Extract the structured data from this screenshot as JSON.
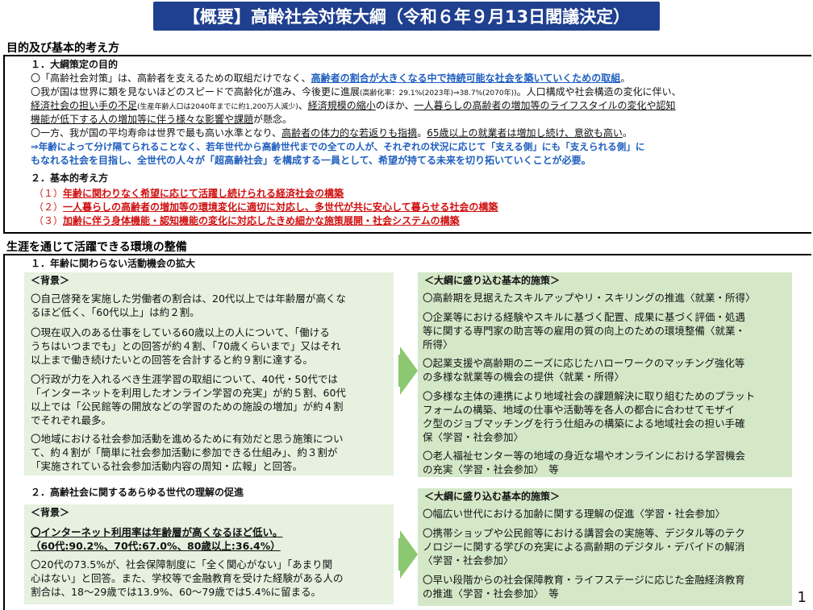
{
  "title": "【概要】高齢社会対策大綱（令和６年９月13日閣議決定）",
  "section1": {
    "heading": "目的及び基本的考え方",
    "sub1": "１．大綱策定の目的",
    "p1a": "〇「高齢社会対策」は、高齢者を支えるための取組だけでなく、",
    "p1b": "高齢者の割合が大きくなる中で持続可能な社会を築いていくための取組",
    "p1c": "。",
    "p2a": "〇我が国は世界に類を見ないほどのスピードで高齢化が進み、今後更に進展",
    "p2b": "(高齢化率：29.1%(2023年)⇒38.7%(2070年))",
    "p2c": "。人口構成や社会構造の変化に伴い、",
    "p3a": "経済社会の担い手の不足",
    "p3b": "(生産年齢人口は2040年までに約1,200万人減少)",
    "p3c": "、",
    "p3d": "経済規模の縮小",
    "p3e": "のほか、",
    "p3f": "一人暮らしの高齢者の増加等のライフスタイルの変化や認知",
    "p4a": "機能が低下する人の増加等に伴う様々な影響や課題",
    "p4b": "が懸念。",
    "p5a": "〇一方、我が国の平均寿命は世界で最も高い水準となり、",
    "p5b": "高齢者の体力的な若返りも指摘",
    "p5c": "。",
    "p5d": "65歳以上の就業者は増加し続け、意欲も高い",
    "p5e": "。",
    "p6": "⇒年齢によって分け隔てられることなく、若年世代から高齢世代までの全ての人が、それぞれの状況に応じて「支える側」にも「支えられる側」に",
    "p7": "もなれる社会を目指し、全世代の人々が「超高齢社会」を構成する一員として、希望が持てる未来を切り拓いていくことが必要。",
    "sub2": "２．基本的考え方",
    "items": [
      {
        "num": "（１）",
        "text": "年齢に関わりなく希望に応じて活躍し続けられる経済社会の構築"
      },
      {
        "num": "（２）",
        "text": "一人暮らしの高齢者の増加等の環境変化に適切に対応し、多世代が共に安心して暮らせる社会の構築"
      },
      {
        "num": "（３）",
        "text": "加齢に伴う身体機能・認知機能の変化に対応したきめ細かな施策展開・社会システムの構築"
      }
    ]
  },
  "section2": {
    "heading": "生涯を通じて活躍できる環境の整備",
    "sub1": "１．年齢に関わらない活動機会の拡大",
    "bg_label": "＜背景＞",
    "left1": [
      "〇自己啓発を実施した労働者の割合は、20代以上では年齢層が高くな",
      "るほど低く、「60代以上」は約２割。",
      "〇現在収入のある仕事をしている60歳以上の人について、「働ける",
      "うちはいつまでも」との回答が約４割、「70歳くらいまで」又はそれ",
      "以上まで働き続けたいとの回答を合計すると約９割に達する。",
      "〇行政が力を入れるべき生涯学習の取組について、40代・50代では",
      "「インターネットを利用したオンライン学習の充実」が約５割、60代",
      "以上では「公民館等の開放などの学習のための施設の増加」が約４割",
      "でそれぞれ最多。",
      "〇地域における社会参加活動を進めるために有効だと思う施策につい",
      "て、約４割が「簡単に社会参加活動に参加できる仕組み」、約３割が",
      "「実施されている社会参加活動内容の周知・広報」と回答。"
    ],
    "right_label": "＜大綱に盛り込む基本的施策＞",
    "right1": [
      "〇高齢期を見据えたスキルアップやリ・スキリングの推進〈就業・所得〉",
      "〇企業等における経験やスキルに基づく配置、成果に基づく評価・処遇",
      "等に関する専門家の助言等の雇用の質の向上のための環境整備〈就業・",
      "所得〉",
      "〇起業支援や高齢期のニーズに応じたハローワークのマッチング強化等",
      "の多様な就業等の機会の提供〈就業・所得〉",
      "〇多様な主体の連携により地域社会の課題解決に取り組むためのプラット",
      "フォームの構築、地域の仕事や活動等を各人の都合に合わせてモザイ",
      "ク型のジョブマッチングを行う仕組みの構築による地域社会の担い手確",
      "保〈学習・社会参加〉",
      "〇老人福祉センター等の地域の身近な場やオンラインにおける学習機会",
      "の充実〈学習・社会参加〉　等"
    ],
    "sub2": "２．高齢社会に関するあらゆる世代の理解の促進",
    "left2": [
      "〇インターネット利用率は年齢層が高くなるほど低い。",
      "（60代:90.2%、70代:67.0%、80歳以上:36.4%）",
      "〇20代の73.5%が、社会保障制度に「全く関心がない」「あまり関",
      "心はない」と回答。また、学校等で金融教育を受けた経験がある人の",
      "割合は、18～29歳では13.9%、60～79歳では5.4%に留まる。"
    ],
    "right2": [
      "〇幅広い世代における加齢に関する理解の促進〈学習・社会参加〉",
      "〇携帯ショップや公民館等における講習会の実施等、デジタル等のテク",
      "ノロジーに関する学びの充実による高齢期のデジタル・デバイドの解消",
      "〈学習・社会参加〉",
      "〇早い段階からの社会保障教育・ライフステージに応じた金融経済教育",
      "の推進〈学習・社会参加〉　等"
    ]
  },
  "page_number": "1"
}
